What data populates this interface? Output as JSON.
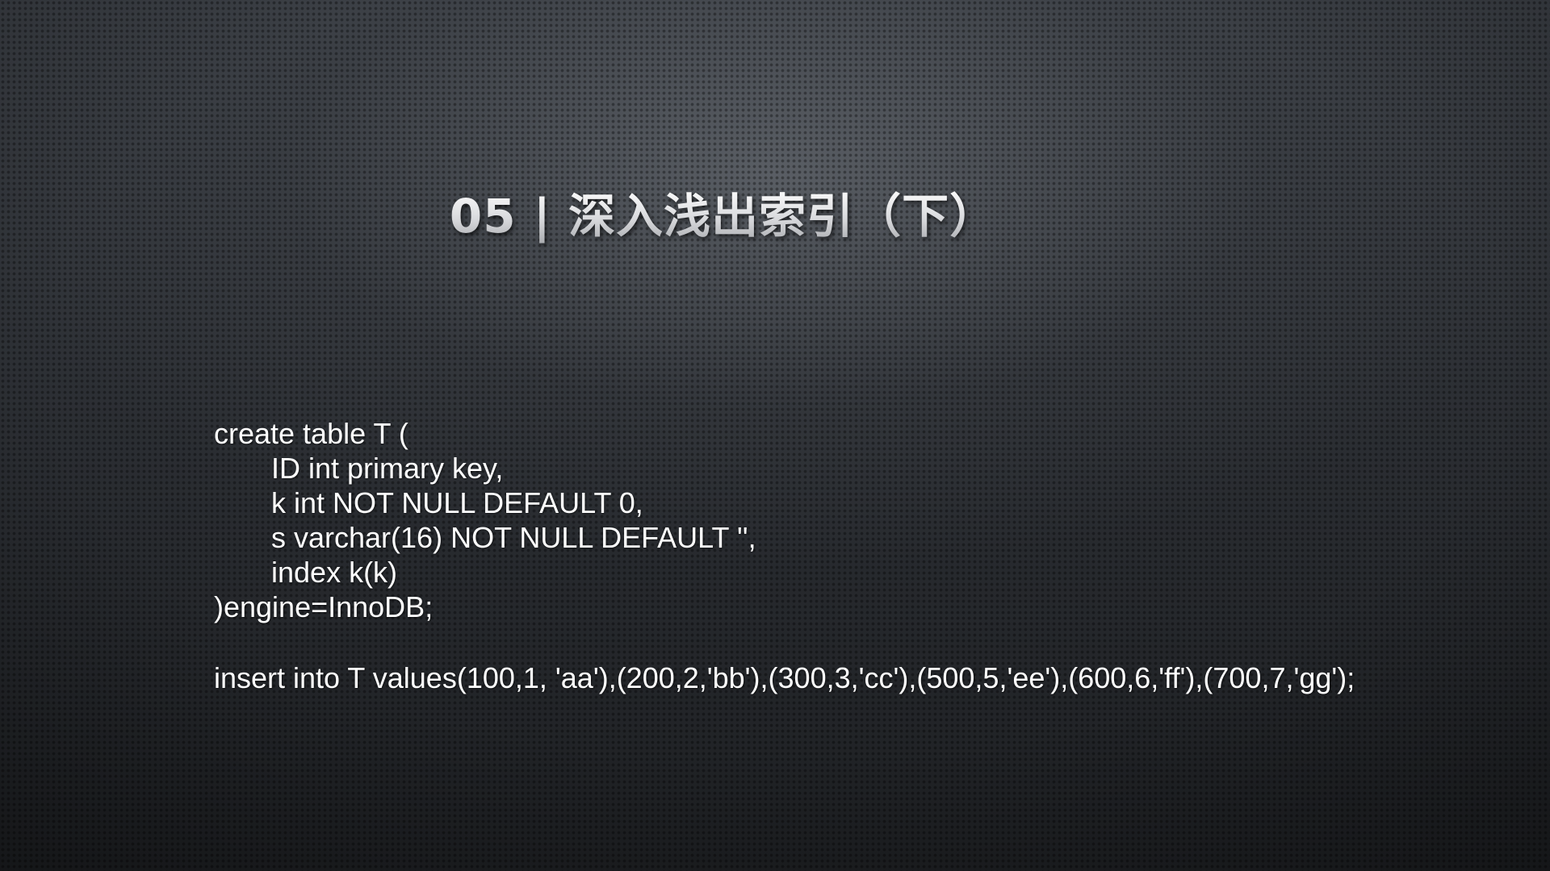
{
  "slide": {
    "title": "05 | 深入浅出索引（下）",
    "code": {
      "create_lines": [
        "create table T (",
        "ID int primary key,",
        "k int NOT NULL DEFAULT 0,",
        "s varchar(16) NOT NULL DEFAULT '',",
        "index k(k)",
        ")engine=InnoDB;"
      ],
      "insert_line": "insert into T values(100,1, 'aa'),(200,2,'bb'),(300,3,'cc'),(500,5,'ee'),(600,6,'ff'),(700,7,'gg');"
    }
  },
  "colors": {
    "background": "#2a2d31",
    "text": "#ffffff"
  }
}
